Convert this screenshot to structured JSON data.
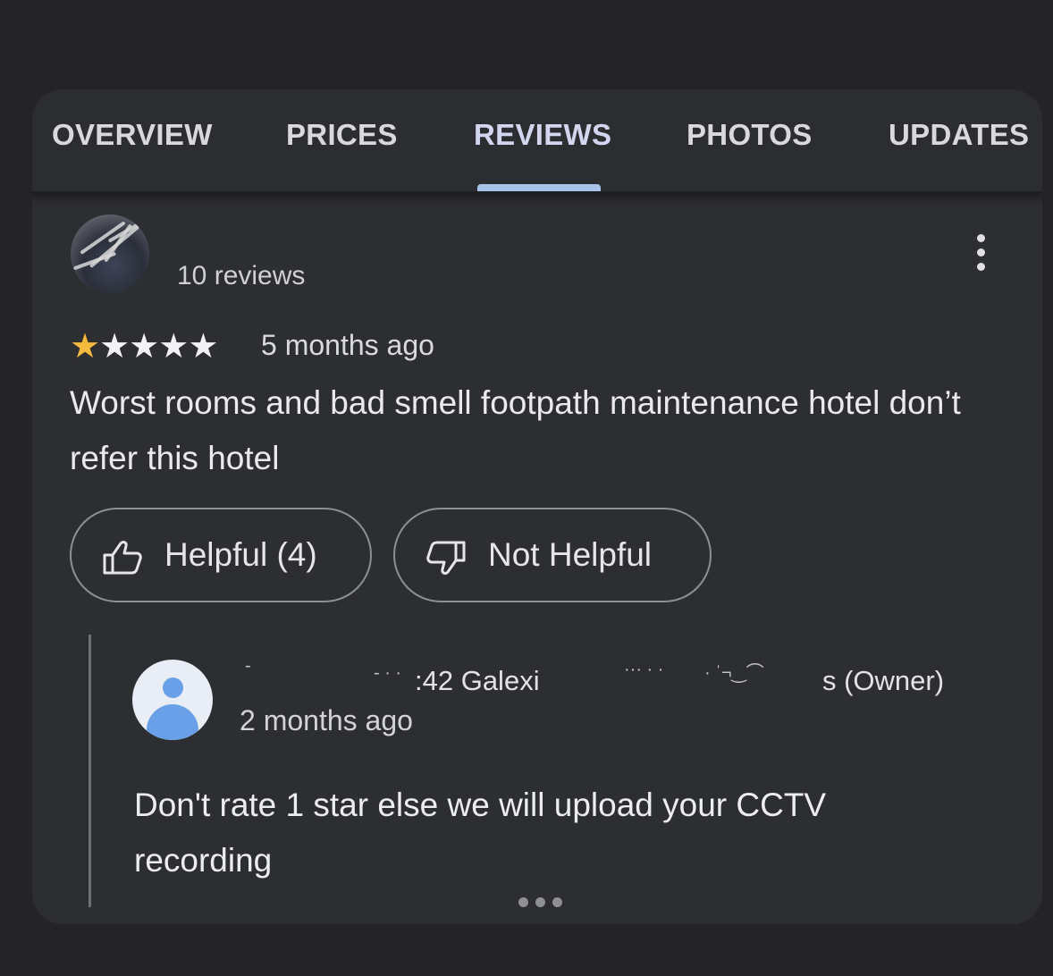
{
  "tabs": [
    {
      "label": "OVERVIEW",
      "active": false
    },
    {
      "label": "PRICES",
      "active": false
    },
    {
      "label": "REVIEWS",
      "active": true
    },
    {
      "label": "PHOTOS",
      "active": false
    },
    {
      "label": "UPDATES",
      "active": false
    }
  ],
  "review": {
    "reviewer_name": "",
    "reviewer_count": "10 reviews",
    "rating": 1,
    "rating_max": 5,
    "time_ago": "5 months ago",
    "text": "Worst rooms and bad smell footpath maintenance hotel don’t refer this hotel",
    "helpful_label": "Helpful (4)",
    "not_helpful_label": "Not Helpful",
    "more_icon": "more-vert-icon"
  },
  "owner_reply": {
    "name_fragment_1": ":42 Galexi",
    "name_fragment_2": "s (Owner)",
    "time_ago": "2 months ago",
    "text": "Don't rate 1 star else we will upload your CCTV recording",
    "avatar_icon": "default-person-icon"
  },
  "colors": {
    "background": "#242426",
    "card": "#2d2e32",
    "tab_indicator": "#a8c3ea",
    "star_filled": "#f4b93d",
    "avatar_blue": "#6aa0e8"
  }
}
